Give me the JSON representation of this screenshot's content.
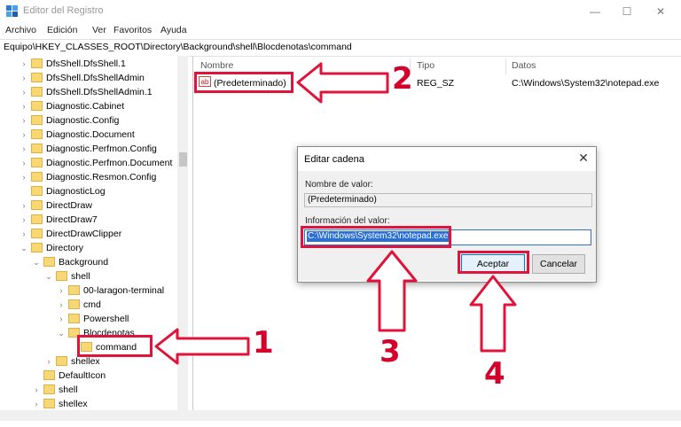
{
  "window": {
    "title": "Editor del Registro",
    "minimize": "—",
    "maximize": "☐",
    "close": "✕"
  },
  "menu": [
    "Archivo",
    "Edición",
    "Ver",
    "Favoritos",
    "Ayuda"
  ],
  "address": "Equipo\\HKEY_CLASSES_ROOT\\Directory\\Background\\shell\\Blocdenotas\\command",
  "tree": [
    {
      "label": "DfsShell.DfsShell.1",
      "chev": "›"
    },
    {
      "label": "DfsShell.DfsShellAdmin",
      "chev": "›"
    },
    {
      "label": "DfsShell.DfsShellAdmin.1",
      "chev": "›"
    },
    {
      "label": "Diagnostic.Cabinet",
      "chev": "›"
    },
    {
      "label": "Diagnostic.Config",
      "chev": "›"
    },
    {
      "label": "Diagnostic.Document",
      "chev": "›"
    },
    {
      "label": "Diagnostic.Perfmon.Config",
      "chev": "›"
    },
    {
      "label": "Diagnostic.Perfmon.Document",
      "chev": "›"
    },
    {
      "label": "Diagnostic.Resmon.Config",
      "chev": "›"
    },
    {
      "label": "DiagnosticLog",
      "chev": ""
    },
    {
      "label": "DirectDraw",
      "chev": "›"
    },
    {
      "label": "DirectDraw7",
      "chev": "›"
    },
    {
      "label": "DirectDrawClipper",
      "chev": "›"
    },
    {
      "label": "Directory",
      "chev": "⌄"
    },
    {
      "label": "Background",
      "chev": "⌄"
    },
    {
      "label": "shell",
      "chev": "⌄"
    },
    {
      "label": "00-laragon-terminal",
      "chev": "›"
    },
    {
      "label": "cmd",
      "chev": "›"
    },
    {
      "label": "Powershell",
      "chev": "›"
    },
    {
      "label": "Blocdenotas",
      "chev": "⌄"
    },
    {
      "label": "command",
      "chev": ""
    },
    {
      "label": "shellex",
      "chev": "›"
    },
    {
      "label": "DefaultIcon",
      "chev": ""
    },
    {
      "label": "shell",
      "chev": "›"
    },
    {
      "label": "shellex",
      "chev": "›"
    }
  ],
  "list": {
    "headers": {
      "name": "Nombre",
      "type": "Tipo",
      "data": "Datos"
    },
    "rows": [
      {
        "icon": "ab",
        "name": "(Predeterminado)",
        "type": "REG_SZ",
        "data": "C:\\Windows\\System32\\notepad.exe"
      }
    ]
  },
  "dialog": {
    "title": "Editar cadena",
    "close": "✕",
    "name_label": "Nombre de valor:",
    "name_value": "(Predeterminado)",
    "value_label": "Información del valor:",
    "value_value": "C:\\Windows\\System32\\notepad.exe",
    "ok": "Aceptar",
    "cancel": "Cancelar"
  },
  "annotations": {
    "n1": "1",
    "n2": "2",
    "n3": "3",
    "n4": "4",
    "color": "#e0143a"
  }
}
